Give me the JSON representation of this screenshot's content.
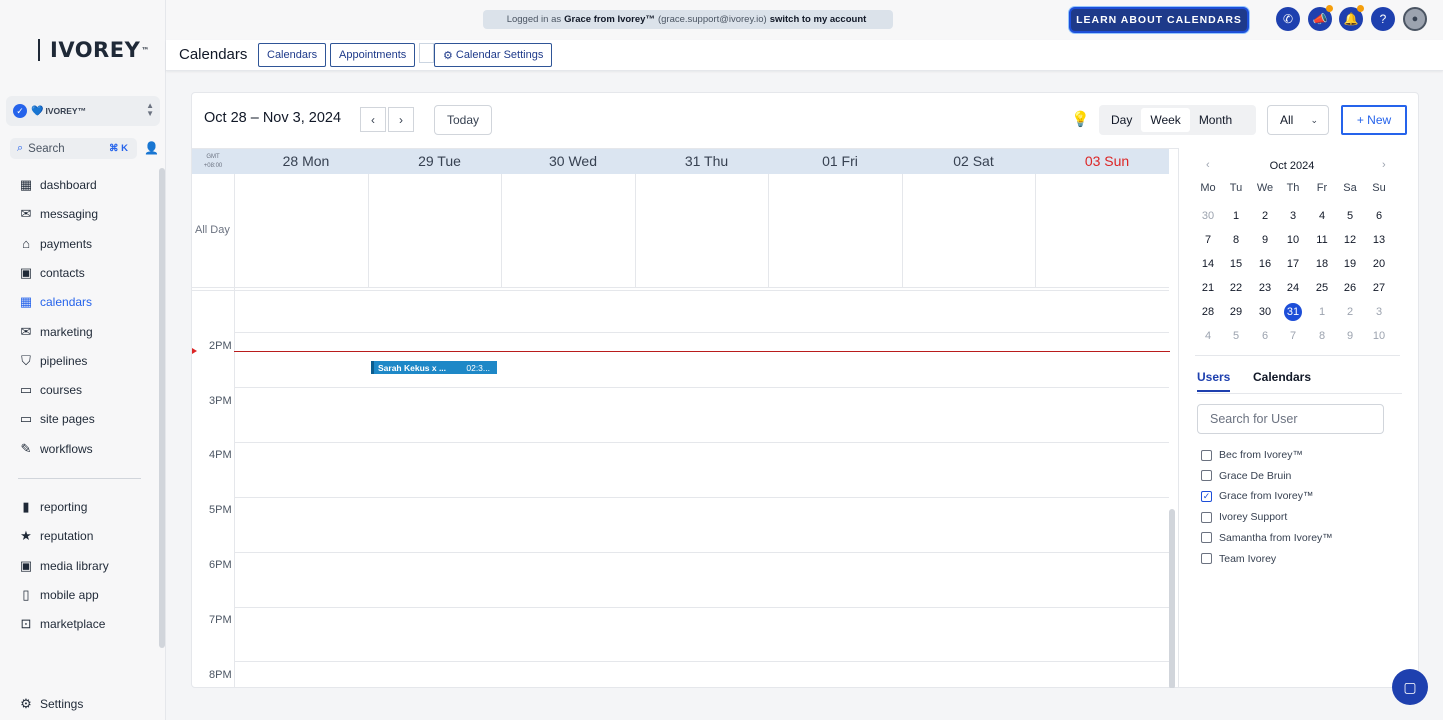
{
  "brand": {
    "name": "IVOREY",
    "tm": "™"
  },
  "account": {
    "name": "IVOREY™",
    "heart": "💙"
  },
  "search": {
    "label": "Search",
    "shortcut": "⌘ K"
  },
  "nav": [
    {
      "label": "dashboard",
      "icon": "dashboard-icon",
      "glyph": "▦"
    },
    {
      "label": "messaging",
      "icon": "chat-icon",
      "glyph": "✉"
    },
    {
      "label": "payments",
      "icon": "payments-icon",
      "glyph": "⌂"
    },
    {
      "label": "contacts",
      "icon": "contacts-icon",
      "glyph": "▣"
    },
    {
      "label": "calendars",
      "icon": "calendar-icon",
      "glyph": "▦"
    },
    {
      "label": "marketing",
      "icon": "envelope-icon",
      "glyph": "✉"
    },
    {
      "label": "pipelines",
      "icon": "filter-icon",
      "glyph": "⛉"
    },
    {
      "label": "courses",
      "icon": "courses-icon",
      "glyph": "▭"
    },
    {
      "label": "site pages",
      "icon": "monitor-icon",
      "glyph": "▭"
    },
    {
      "label": "workflows",
      "icon": "wand-icon",
      "glyph": "✎"
    }
  ],
  "nav2": [
    {
      "label": "reporting",
      "icon": "chart-icon",
      "glyph": "▮"
    },
    {
      "label": "reputation",
      "icon": "star-icon",
      "glyph": "★"
    },
    {
      "label": "media library",
      "icon": "image-icon",
      "glyph": "▣"
    },
    {
      "label": "mobile app",
      "icon": "phone-icon",
      "glyph": "▯"
    },
    {
      "label": "marketplace",
      "icon": "cart-icon",
      "glyph": "⊡"
    }
  ],
  "settings": {
    "label": "Settings"
  },
  "topbar": {
    "logged_prefix": "Logged in as",
    "logged_user": "Grace from Ivorey™",
    "logged_email": "(grace.support@ivorey.io)",
    "switch": "switch to my account",
    "learn": "LEARN ABOUT CALENDARS"
  },
  "header": {
    "title": "Calendars",
    "tabs": [
      "Calendars",
      "Appointments"
    ],
    "settings": "Calendar Settings"
  },
  "toolbar": {
    "range": "Oct 28 – Nov 3, 2024",
    "today": "Today",
    "views": [
      "Day",
      "Week",
      "Month"
    ],
    "selected_view": "Week",
    "filter": "All",
    "new": "+ New"
  },
  "week": {
    "tz": [
      "GMT",
      "+08:00"
    ],
    "days": [
      "28 Mon",
      "29 Tue",
      "30 Wed",
      "31 Thu",
      "01 Fri",
      "02 Sat",
      "03 Sun"
    ],
    "allday": "All Day",
    "hours": [
      "2PM",
      "3PM",
      "4PM",
      "5PM",
      "6PM",
      "7PM",
      "8PM"
    ]
  },
  "event": {
    "title": "Sarah Kekus x ...",
    "time": "02:3..."
  },
  "mini": {
    "month": "Oct 2024",
    "weekdays": [
      "Mo",
      "Tu",
      "We",
      "Th",
      "Fr",
      "Sa",
      "Su"
    ],
    "weeks": [
      [
        "30",
        "1",
        "2",
        "3",
        "4",
        "5",
        "6"
      ],
      [
        "7",
        "8",
        "9",
        "10",
        "11",
        "12",
        "13"
      ],
      [
        "14",
        "15",
        "16",
        "17",
        "18",
        "19",
        "20"
      ],
      [
        "21",
        "22",
        "23",
        "24",
        "25",
        "26",
        "27"
      ],
      [
        "28",
        "29",
        "30",
        "31",
        "1",
        "2",
        "3"
      ],
      [
        "4",
        "5",
        "6",
        "7",
        "8",
        "9",
        "10"
      ]
    ],
    "selected": "31"
  },
  "panel": {
    "tabs": [
      "Users",
      "Calendars"
    ],
    "search_placeholder": "Search for User",
    "users": [
      {
        "name": "Bec from Ivorey™",
        "checked": false
      },
      {
        "name": "Grace De Bruin",
        "checked": false
      },
      {
        "name": "Grace from Ivorey™",
        "checked": true
      },
      {
        "name": "Ivorey Support",
        "checked": false
      },
      {
        "name": "Samantha from Ivorey™",
        "checked": false
      },
      {
        "name": "Team Ivorey",
        "checked": false
      }
    ]
  },
  "colors": {
    "accent": "#2563eb",
    "dark_accent": "#1e40af",
    "now_line": "#b91c1c",
    "event": "#1e88c7",
    "sunday": "#dc2626"
  }
}
